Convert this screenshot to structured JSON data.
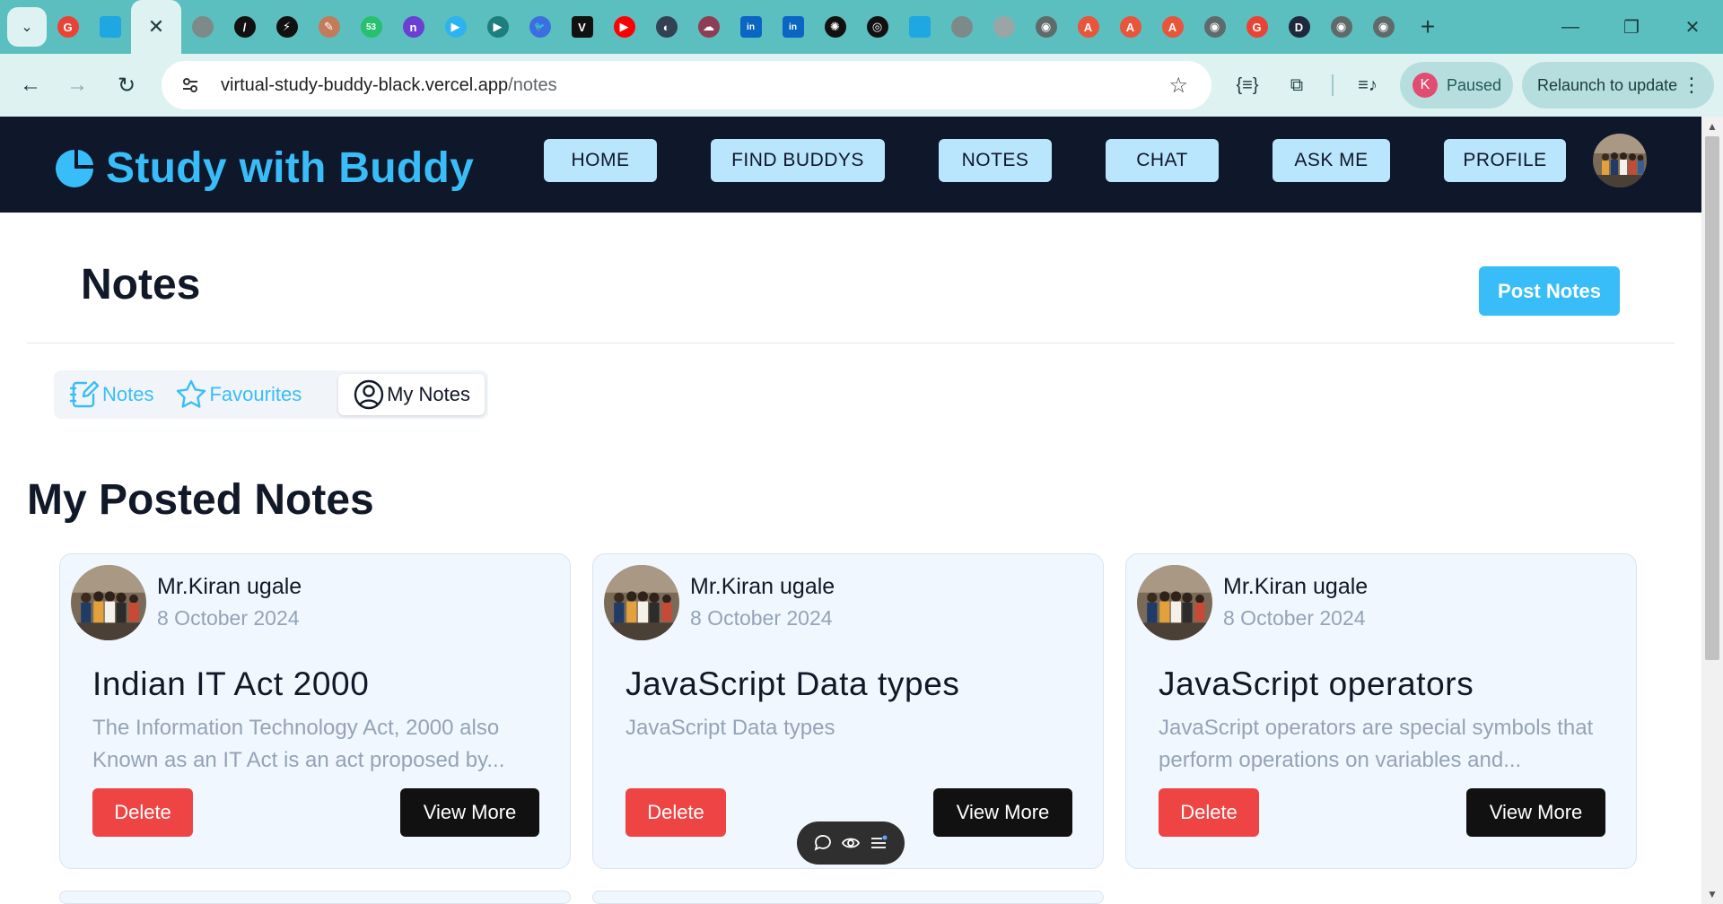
{
  "browser": {
    "tab_favicons": [
      {
        "icon": "google-g-icon",
        "color": "#ea4335",
        "glyph": "G"
      },
      {
        "icon": "app-square-icon",
        "color": "#1ea7e1",
        "glyph": ""
      },
      {
        "icon": "globe-icon",
        "color": "#7d8a8a",
        "glyph": ""
      },
      {
        "icon": "slash-circle-icon",
        "color": "#111111",
        "glyph": "/"
      },
      {
        "icon": "bolt-circle-icon",
        "color": "#111111",
        "glyph": "⚡"
      },
      {
        "icon": "feather-icon",
        "color": "#c27c5a",
        "glyph": "✎"
      },
      {
        "icon": "chat-bubble-icon",
        "color": "#25c16f",
        "glyph": "53"
      },
      {
        "icon": "n-circle-icon",
        "color": "#6b3fd1",
        "glyph": "n"
      },
      {
        "icon": "play-store-icon",
        "color": "#2db3f0",
        "glyph": "▶"
      },
      {
        "icon": "media-play-icon",
        "color": "#1e7d7d",
        "glyph": "▶"
      },
      {
        "icon": "bird-icon",
        "color": "#3b6fe0",
        "glyph": "🐦"
      },
      {
        "icon": "v-logo-icon",
        "color": "#111111",
        "glyph": "V"
      },
      {
        "icon": "youtube-icon",
        "color": "#ff0000",
        "glyph": "▶"
      },
      {
        "icon": "astronaut-icon",
        "color": "#334155",
        "glyph": "◐"
      },
      {
        "icon": "cloud-icon",
        "color": "#8f3d54",
        "glyph": "☁"
      },
      {
        "icon": "linkedin-icon",
        "color": "#0a66c2",
        "glyph": "in"
      },
      {
        "icon": "linkedin-icon",
        "color": "#0a66c2",
        "glyph": "in"
      },
      {
        "icon": "openai-icon",
        "color": "#111111",
        "glyph": "✺"
      },
      {
        "icon": "github-icon",
        "color": "#111111",
        "glyph": "◎"
      },
      {
        "icon": "app-square-icon",
        "color": "#1ea7e1",
        "glyph": ""
      },
      {
        "icon": "globe-icon",
        "color": "#7d8a8a",
        "glyph": ""
      },
      {
        "icon": "globe-icon",
        "color": "#9aa6a6",
        "glyph": ""
      },
      {
        "icon": "chromium-icon",
        "color": "#5f6b6b",
        "glyph": "◉"
      },
      {
        "icon": "a-triangle-icon",
        "color": "#e8553a",
        "glyph": "A"
      },
      {
        "icon": "a-triangle-icon",
        "color": "#e8553a",
        "glyph": "A"
      },
      {
        "icon": "a-triangle-icon",
        "color": "#e8553a",
        "glyph": "A"
      },
      {
        "icon": "chromium-icon",
        "color": "#5f6b6b",
        "glyph": "◉"
      },
      {
        "icon": "google-g-icon",
        "color": "#ea4335",
        "glyph": "G"
      },
      {
        "icon": "d-circle-icon",
        "color": "#1e293b",
        "glyph": "D"
      },
      {
        "icon": "chromium-icon",
        "color": "#5f6b6b",
        "glyph": "◉"
      },
      {
        "icon": "chromium-icon",
        "color": "#5f6b6b",
        "glyph": "◉"
      }
    ],
    "url_host": "virtual-study-buddy-black.vercel.app",
    "url_path": "/notes",
    "profile_initial": "K",
    "profile_status": "Paused",
    "relaunch_label": "Relaunch to update"
  },
  "header": {
    "brand": "Study with Buddy",
    "nav": [
      "HOME",
      "FIND BUDDYS",
      "NOTES",
      "CHAT",
      "ASK ME",
      "PROFILE"
    ]
  },
  "page": {
    "title": "Notes",
    "post_button": "Post Notes",
    "tabs": [
      "Notes",
      "Favourites",
      "My Notes"
    ],
    "selected_tab": "My Notes",
    "section_title": "My Posted Notes"
  },
  "cards": [
    {
      "author": "Mr.Kiran ugale",
      "date": "8 October 2024",
      "title": "Indian IT Act 2000",
      "description": "The Information Technology Act, 2000 also Known as an IT Act is an act proposed by...",
      "delete_label": "Delete",
      "view_label": "View More"
    },
    {
      "author": "Mr.Kiran ugale",
      "date": "8 October 2024",
      "title": "JavaScript Data types",
      "description": "JavaScript Data types",
      "delete_label": "Delete",
      "view_label": "View More"
    },
    {
      "author": "Mr.Kiran ugale",
      "date": "8 October 2024",
      "title": "JavaScript operators",
      "description": "JavaScript operators are special symbols that perform operations on variables and...",
      "delete_label": "Delete",
      "view_label": "View More"
    }
  ],
  "colors": {
    "brand": "#38bdf8",
    "header_bg": "#0f172a",
    "delete": "#ef4444",
    "view_more": "#111111",
    "card_bg": "#f0f7ff"
  }
}
